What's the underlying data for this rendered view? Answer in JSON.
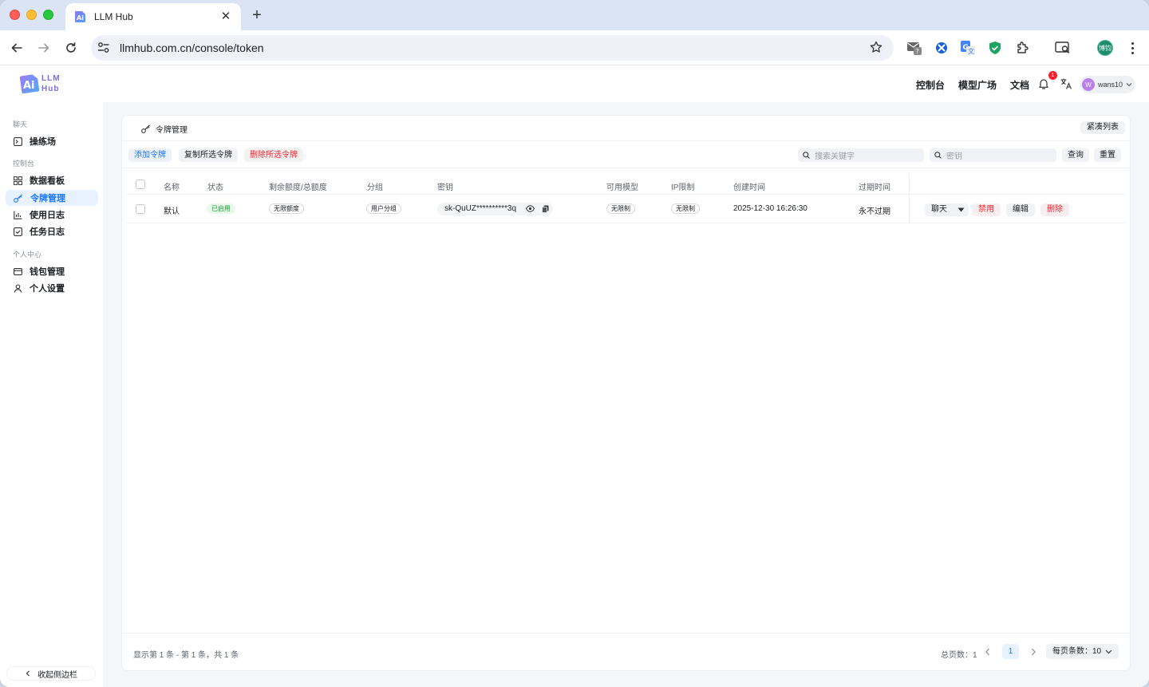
{
  "browser": {
    "tab_title": "LLM Hub",
    "url": "llmhub.com.cn/console/token",
    "profile_initials": "博钧",
    "tab_close": "✕",
    "new_tab": "+"
  },
  "header": {
    "logo_line1": "LLM",
    "logo_line2": "Hub",
    "nav": [
      "控制台",
      "模型广场",
      "文档"
    ],
    "notification_count": "1",
    "user_initial": "W",
    "username": "wans10"
  },
  "sidebar": {
    "sections": [
      "聊天",
      "控制台",
      "个人中心"
    ],
    "items": [
      {
        "label": "操练场",
        "icon": "playground-icon"
      },
      {
        "label": "数据看板",
        "icon": "dashboard-icon"
      },
      {
        "label": "令牌管理",
        "icon": "key-icon",
        "active": true
      },
      {
        "label": "使用日志",
        "icon": "chart-icon"
      },
      {
        "label": "任务日志",
        "icon": "task-icon"
      },
      {
        "label": "钱包管理",
        "icon": "wallet-icon"
      },
      {
        "label": "个人设置",
        "icon": "user-icon"
      }
    ],
    "collapse_label": "收起侧边栏"
  },
  "card": {
    "title": "令牌管理",
    "compact_label": "紧凑列表",
    "add_label": "添加令牌",
    "copy_label": "复制所选令牌",
    "delete_label": "删除所选令牌",
    "search_placeholder": "搜索关键字",
    "key_placeholder": "密钥",
    "query_label": "查询",
    "reset_label": "重置"
  },
  "table": {
    "columns": [
      "名称",
      "状态",
      "剩余额度/总额度",
      "分组",
      "密钥",
      "可用模型",
      "IP限制",
      "创建时间",
      "过期时间"
    ],
    "rows": [
      {
        "name": "默认",
        "status": "已启用",
        "quota": "无限额度",
        "group": "用户分组",
        "key": "sk-QuUZ**********3q",
        "models": "无限制",
        "ip": "无限制",
        "created": "2025-12-30 16:26:30",
        "expires": "永不过期",
        "actions": {
          "chat": "聊天",
          "disable": "禁用",
          "edit": "编辑",
          "delete": "删除"
        }
      }
    ]
  },
  "pagination": {
    "info": "显示第 1 条 - 第 1 条，共 1 条",
    "total_pages": "总页数：1",
    "current": "1",
    "page_size": "每页条数：10"
  },
  "colors": {
    "accent": "#1677ff",
    "danger": "#f5222d",
    "success": "#1a9e38"
  }
}
